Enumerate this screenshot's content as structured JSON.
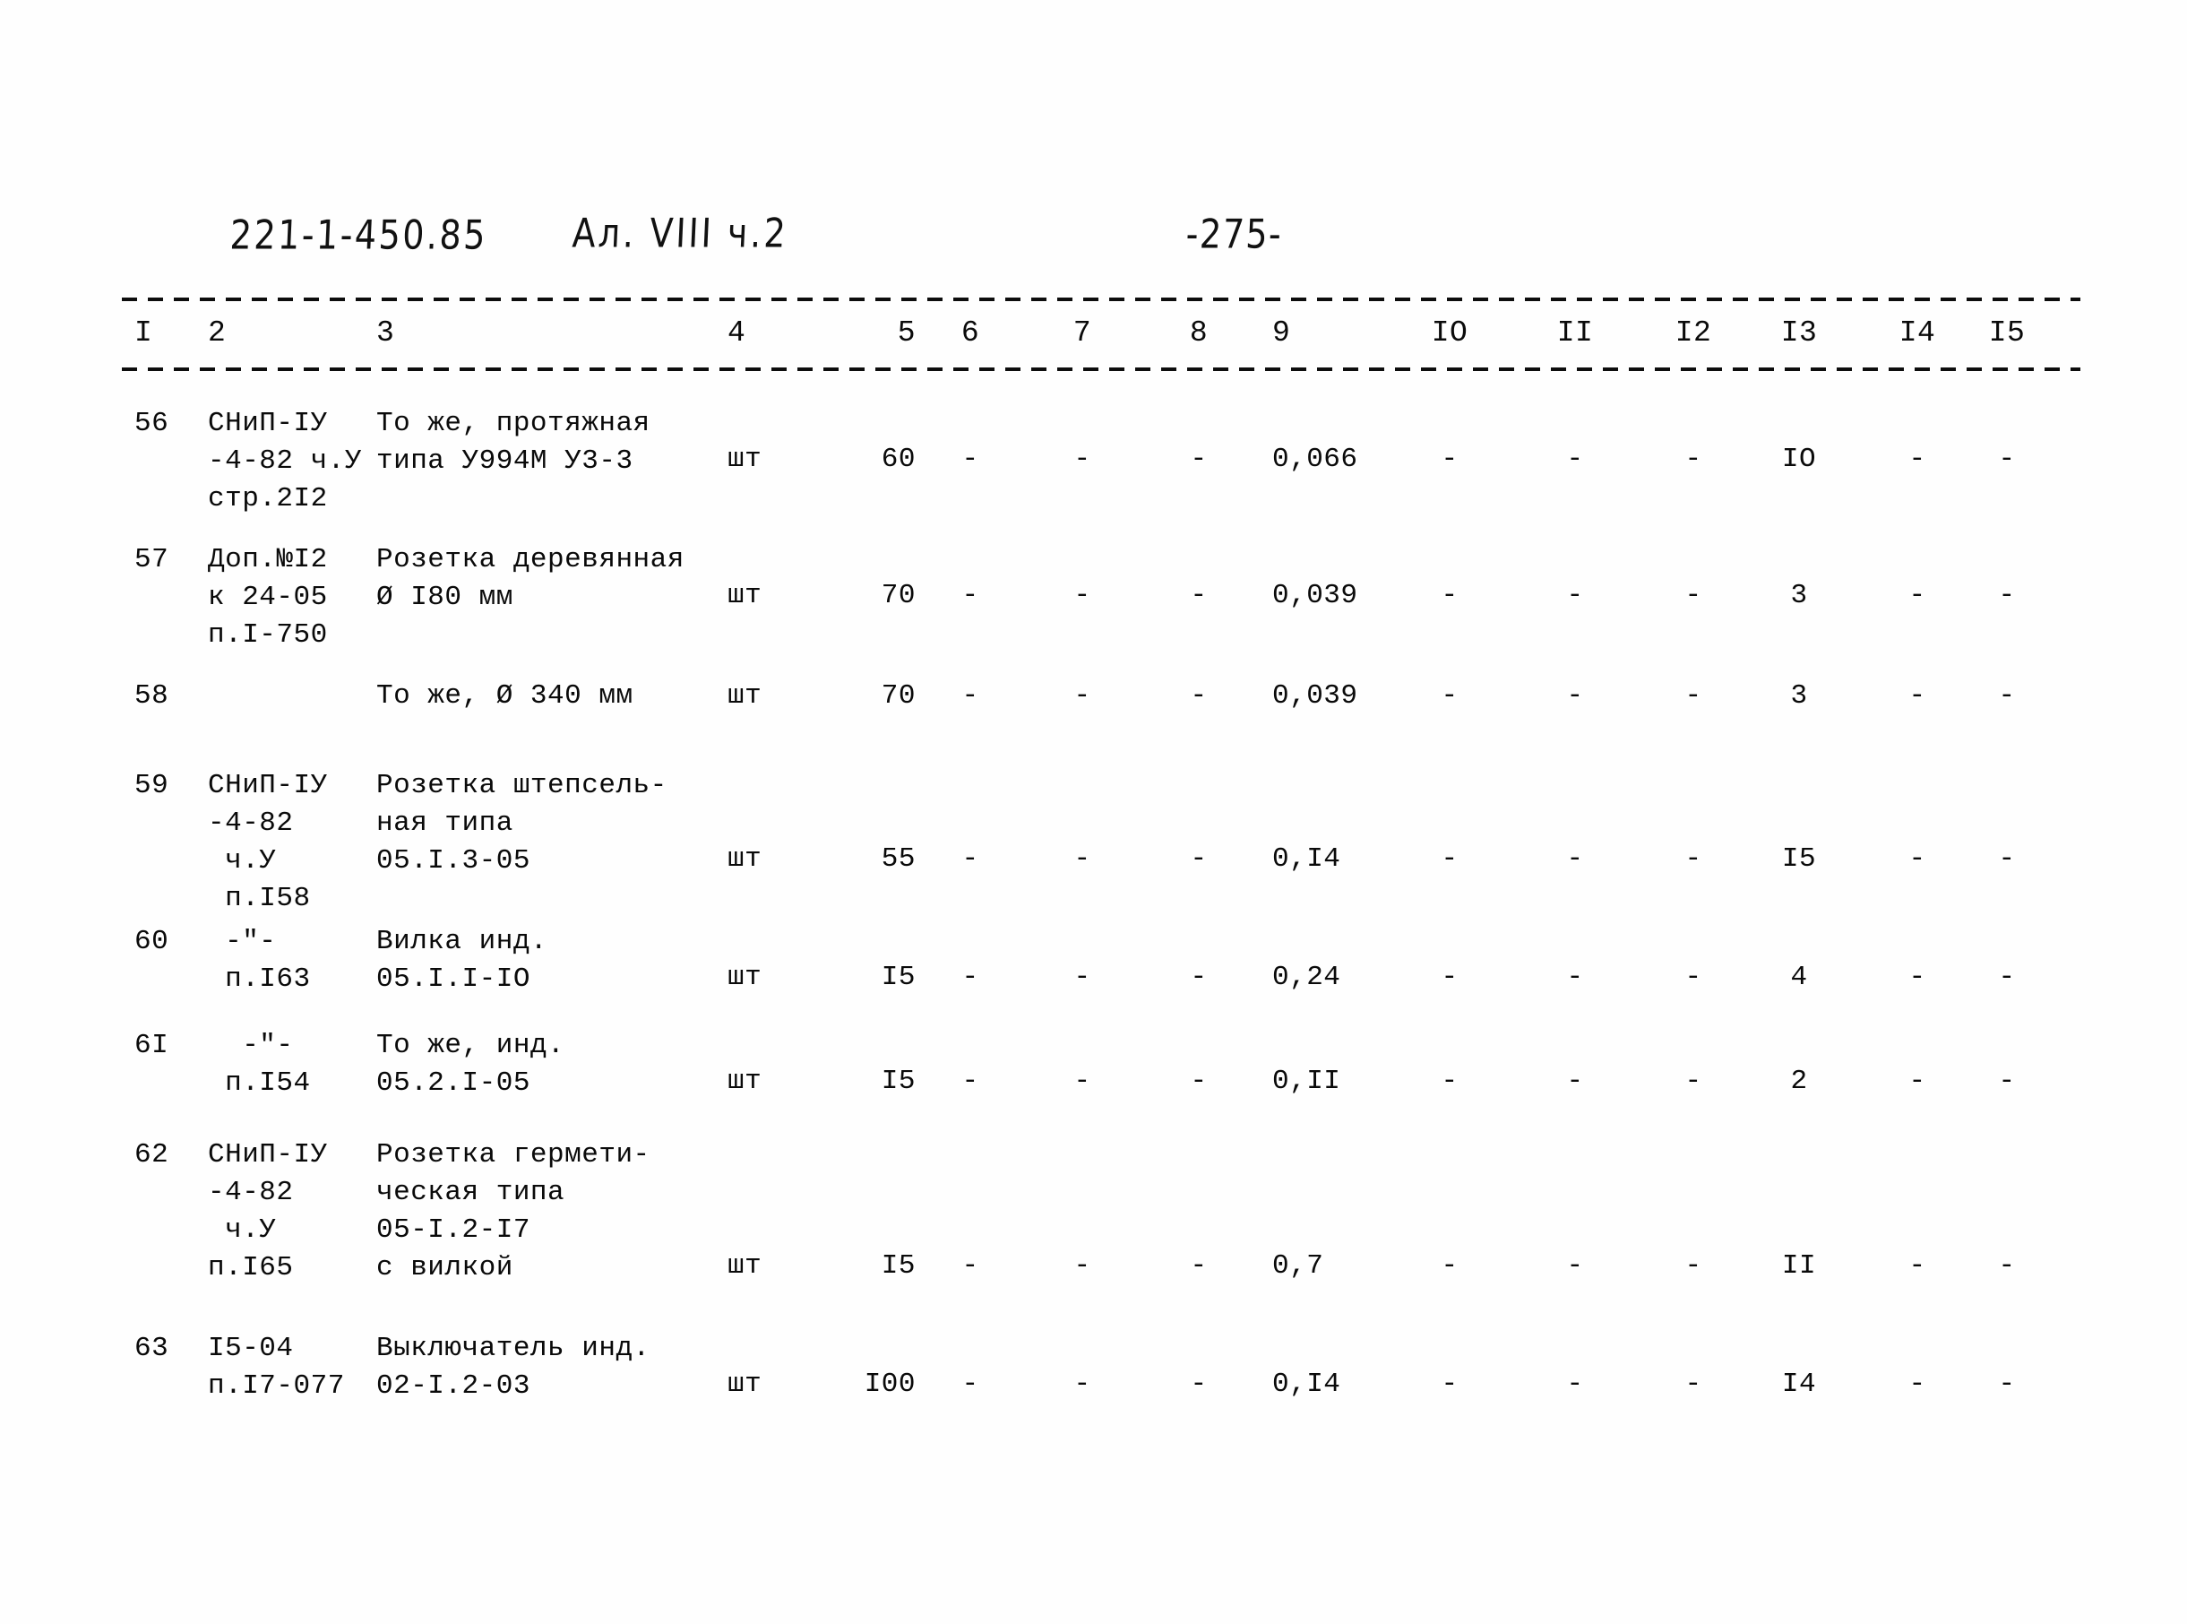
{
  "header": {
    "project_code": "221-1-450.85",
    "album": "Ал. VIII ч.2",
    "page_number": "-275-"
  },
  "table": {
    "column_headers": [
      "I",
      "2",
      "3",
      "4",
      "5",
      "6",
      "7",
      "8",
      "9",
      "IO",
      "II",
      "I2",
      "I3",
      "I4",
      "I5"
    ],
    "rows": [
      {
        "num": "56",
        "source": "СНиП-IУ\n-4-82 ч.У\nстр.2I2",
        "description": "То же, протяжная\nтипа У994М У3-3",
        "unit": "шт",
        "qty": "60",
        "c6": "-",
        "c7": "-",
        "c8": "-",
        "c9": "0,066",
        "c10": "-",
        "c11": "-",
        "c12": "-",
        "c13": "IO",
        "c14": "-",
        "c15": "-"
      },
      {
        "num": "57",
        "source": "Доп.№I2\nк 24-05\nп.I-750",
        "description": "Розетка деревянная\nØ I80 мм",
        "unit": "шт",
        "qty": "70",
        "c6": "-",
        "c7": "-",
        "c8": "-",
        "c9": "0,039",
        "c10": "-",
        "c11": "-",
        "c12": "-",
        "c13": "3",
        "c14": "-",
        "c15": "-"
      },
      {
        "num": "58",
        "source": "",
        "description": "То же, Ø 340 мм",
        "unit": "шт",
        "qty": "70",
        "c6": "-",
        "c7": "-",
        "c8": "-",
        "c9": "0,039",
        "c10": "-",
        "c11": "-",
        "c12": "-",
        "c13": "3",
        "c14": "-",
        "c15": "-"
      },
      {
        "num": "59",
        "source": "СНиП-IУ\n-4-82\n ч.У\n п.I58",
        "description": "Розетка штепсель-\nная типа\n05.I.3-05",
        "unit": "шт",
        "qty": "55",
        "c6": "-",
        "c7": "-",
        "c8": "-",
        "c9": "0,I4",
        "c10": "-",
        "c11": "-",
        "c12": "-",
        "c13": "I5",
        "c14": "-",
        "c15": "-"
      },
      {
        "num": "60",
        "source": " -\"-\n п.I63",
        "description": "Вилка инд.\n05.I.I-IO",
        "unit": "шт",
        "qty": "I5",
        "c6": "-",
        "c7": "-",
        "c8": "-",
        "c9": "0,24",
        "c10": "-",
        "c11": "-",
        "c12": "-",
        "c13": "4",
        "c14": "-",
        "c15": "-"
      },
      {
        "num": "6I",
        "source": "  -\"-\n п.I54",
        "description": "То же, инд.\n05.2.I-05",
        "unit": "шт",
        "qty": "I5",
        "c6": "-",
        "c7": "-",
        "c8": "-",
        "c9": "0,II",
        "c10": "-",
        "c11": "-",
        "c12": "-",
        "c13": "2",
        "c14": "-",
        "c15": "-"
      },
      {
        "num": "62",
        "source": "СНиП-IУ\n-4-82\n ч.У\nп.I65",
        "description": "Розетка гермети-\nческая типа\n05-I.2-I7\nс вилкой",
        "unit": "шт",
        "qty": "I5",
        "c6": "-",
        "c7": "-",
        "c8": "-",
        "c9": "0,7",
        "c10": "-",
        "c11": "-",
        "c12": "-",
        "c13": "II",
        "c14": "-",
        "c15": "-"
      },
      {
        "num": "63",
        "source": "I5-04\nп.I7-077",
        "description": "Выключатель инд.\n02-I.2-03",
        "unit": "шт",
        "qty": "I00",
        "c6": "-",
        "c7": "-",
        "c8": "-",
        "c9": "0,I4",
        "c10": "-",
        "c11": "-",
        "c12": "-",
        "c13": "I4",
        "c14": "-",
        "c15": "-"
      }
    ]
  }
}
